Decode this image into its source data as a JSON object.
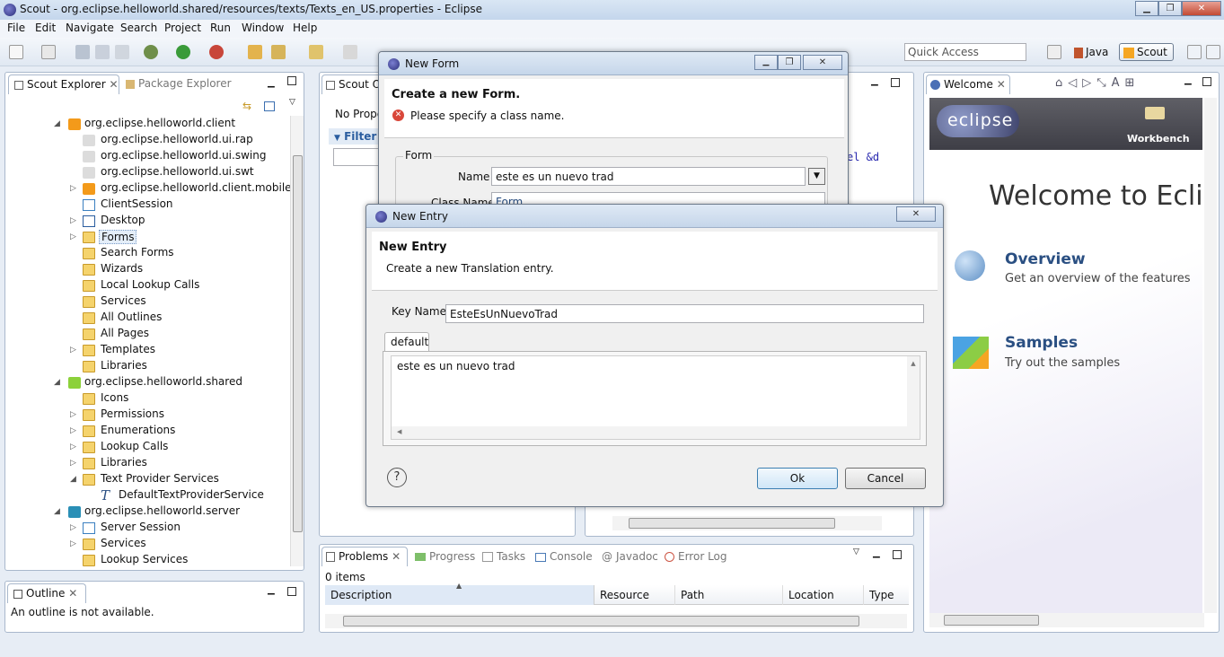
{
  "window": {
    "title": "Scout - org.eclipse.helloworld.shared/resources/texts/Texts_en_US.properties - Eclipse",
    "minimize": "▁",
    "maximize": "❐",
    "close": "✕"
  },
  "menu": [
    "File",
    "Edit",
    "Navigate",
    "Search",
    "Project",
    "Run",
    "Window",
    "Help"
  ],
  "toolbar": {
    "quick_access": "Quick Access",
    "perspective_java": "Java",
    "perspective_scout": "Scout"
  },
  "explorer": {
    "tab_scout": "Scout Explorer",
    "tab_package": "Package Explorer",
    "items": [
      {
        "label": "org.eclipse.helloworld.client"
      },
      {
        "label": "org.eclipse.helloworld.ui.rap"
      },
      {
        "label": "org.eclipse.helloworld.ui.swing"
      },
      {
        "label": "org.eclipse.helloworld.ui.swt"
      },
      {
        "label": "org.eclipse.helloworld.client.mobile"
      },
      {
        "label": "ClientSession"
      },
      {
        "label": "Desktop"
      },
      {
        "label": "Forms"
      },
      {
        "label": "Search Forms"
      },
      {
        "label": "Wizards"
      },
      {
        "label": "Local Lookup Calls"
      },
      {
        "label": "Services"
      },
      {
        "label": "All Outlines"
      },
      {
        "label": "All Pages"
      },
      {
        "label": "Templates"
      },
      {
        "label": "Libraries"
      },
      {
        "label": "org.eclipse.helloworld.shared"
      },
      {
        "label": "Icons"
      },
      {
        "label": "Permissions"
      },
      {
        "label": "Enumerations"
      },
      {
        "label": "Lookup Calls"
      },
      {
        "label": "Libraries"
      },
      {
        "label": "Text Provider Services"
      },
      {
        "label": "DefaultTextProviderService"
      },
      {
        "label": "org.eclipse.helloworld.server"
      },
      {
        "label": "Server Session"
      },
      {
        "label": "Services"
      },
      {
        "label": "Lookup Services"
      }
    ]
  },
  "outline": {
    "tab": "Outline",
    "message": "An outline is not available."
  },
  "scout_object": {
    "tab": "Scout O",
    "no_props": "No Prope",
    "filter": "Filter",
    "code_fragment": "el &d"
  },
  "problems": {
    "tabs": [
      "Problems",
      "Progress",
      "Tasks",
      "Console",
      "Javadoc",
      "Error Log"
    ],
    "count": "0 items",
    "columns": [
      "Description",
      "Resource",
      "Path",
      "Location",
      "Type"
    ]
  },
  "welcome": {
    "tab": "Welcome",
    "logo": "eclipse",
    "workbench": "Workbench",
    "heading": "Welcome to Ecli",
    "overview_title": "Overview",
    "overview_desc": "Get an overview of the features",
    "samples_title": "Samples",
    "samples_desc": "Try out the samples"
  },
  "new_form": {
    "title": "New Form",
    "heading": "Create a new Form.",
    "error": "Please specify a class name.",
    "group": "Form",
    "name_label": "Name",
    "name_value": "este es un nuevo trad",
    "classname_label": "Class Name",
    "classname_value": "Form"
  },
  "new_entry": {
    "title": "New Entry",
    "heading": "New Entry",
    "subheading": "Create a new Translation entry.",
    "key_label": "Key Name",
    "key_value": "EsteEsUnNuevoTrad",
    "tab_default": "default",
    "text_value": "este es un nuevo trad",
    "ok": "Ok",
    "cancel": "Cancel",
    "help": "?"
  }
}
